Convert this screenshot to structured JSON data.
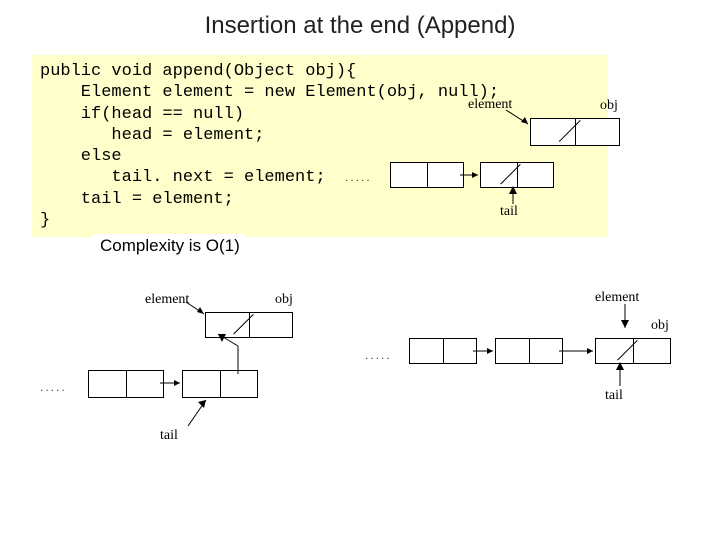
{
  "title": "Insertion at the end (Append)",
  "code": "public void append(Object obj){\n    Element element = new Element(obj, null);\n    if(head == null)\n       head = element;\n    else\n       tail. next = element;\n    tail = element;\n}",
  "complexity": "Complexity is O(1)",
  "labels": {
    "element": "element",
    "obj": "obj",
    "tail": "tail"
  },
  "dots": "....."
}
